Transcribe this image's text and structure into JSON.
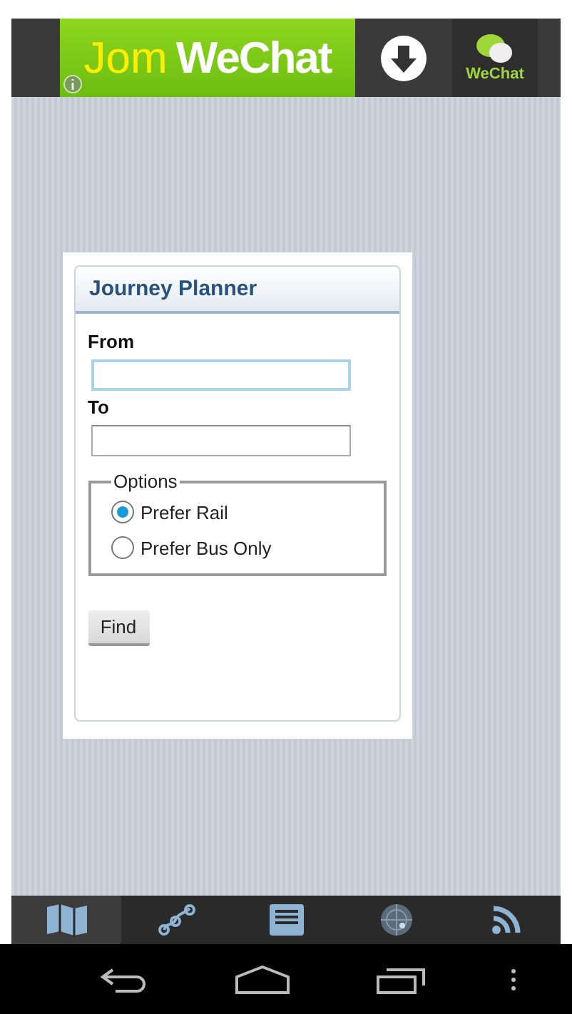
{
  "ad_banner": {
    "headline_part_1": "Jom",
    "headline_part_2": "WeChat",
    "logo_label": "WeChat"
  },
  "journey_planner": {
    "title": "Journey Planner",
    "from_label": "From",
    "from_focused": true,
    "to_label": "To",
    "options_legend": "Options",
    "options": [
      {
        "label": "Prefer Rail",
        "selected": true
      },
      {
        "label": "Prefer Bus Only",
        "selected": false
      }
    ],
    "find_button": "Find"
  },
  "tab_bar": [
    {
      "selected": true
    },
    {
      "selected": false
    },
    {
      "selected": false
    },
    {
      "selected": false
    },
    {
      "selected": false
    }
  ]
}
